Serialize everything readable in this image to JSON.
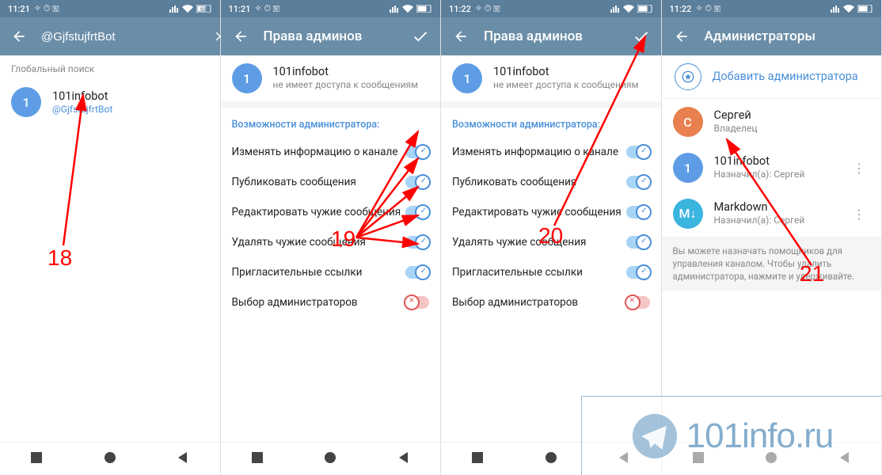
{
  "status": {
    "timeA": "11:21",
    "timeB": "11:22",
    "icons_left": "✧ ⏱ 🅆",
    "battery": "68"
  },
  "screen1": {
    "search_value": "@GjfstujfrtBot",
    "section": "Глобальный поиск",
    "result": {
      "title": "101infobot",
      "sub": "@GjfstujfrtBot",
      "avatar": "1"
    }
  },
  "screen2": {
    "title": "Права админов",
    "bot": {
      "title": "101infobot",
      "sub": "не имеет доступа к сообщениям",
      "avatar": "1"
    },
    "section": "Возможности администратора:",
    "perms": [
      {
        "label": "Изменять информацию о канале",
        "on": true
      },
      {
        "label": "Публиковать сообщения",
        "on": true
      },
      {
        "label": "Редактировать чужие сообщения",
        "on": true
      },
      {
        "label": "Удалять чужие сообщения",
        "on": true
      },
      {
        "label": "Пригласительные ссылки",
        "on": true
      },
      {
        "label": "Выбор администраторов",
        "on": false
      }
    ]
  },
  "screen4": {
    "title": "Администраторы",
    "add": "Добавить администратора",
    "admins": [
      {
        "title": "Сергей",
        "sub": "Владелец",
        "avatar": "С",
        "cls": "avatar-orange",
        "more": false
      },
      {
        "title": "101infobot",
        "sub": "Назначил(а): Сергей",
        "avatar": "1",
        "cls": "avatar-blue",
        "more": true
      },
      {
        "title": "Markdown",
        "sub": "Назначил(а): Сергей",
        "avatar": "M↓",
        "cls": "avatar-teal",
        "more": true
      }
    ],
    "hint": "Вы можете назначать помощников для управления каналом. Чтобы удалить администратора, нажмите и удерживайте."
  },
  "annotations": {
    "n18": "18",
    "n19": "19",
    "n20": "20",
    "n21": "21"
  },
  "watermark": "101info.ru"
}
